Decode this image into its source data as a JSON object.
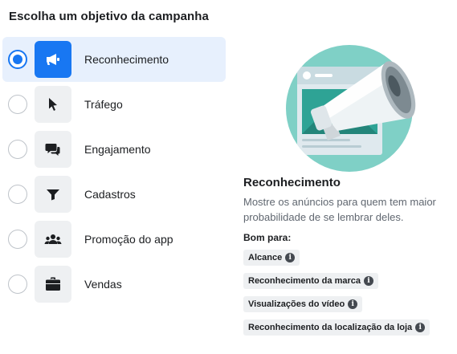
{
  "heading": "Escolha um objetivo da campanha",
  "options": [
    {
      "label": "Reconhecimento",
      "icon": "megaphone-icon",
      "selected": true
    },
    {
      "label": "Tráfego",
      "icon": "cursor-icon",
      "selected": false
    },
    {
      "label": "Engajamento",
      "icon": "chat-bubbles-icon",
      "selected": false
    },
    {
      "label": "Cadastros",
      "icon": "filter-funnel-icon",
      "selected": false
    },
    {
      "label": "Promoção do app",
      "icon": "people-group-icon",
      "selected": false
    },
    {
      "label": "Vendas",
      "icon": "briefcase-icon",
      "selected": false
    }
  ],
  "detail": {
    "title": "Reconhecimento",
    "description": "Mostre os anúncios para quem tem maior probabilidade de se lembrar deles.",
    "good_for_label": "Bom para:",
    "chips": [
      "Alcance",
      "Reconhecimento da marca",
      "Visualizações do vídeo",
      "Reconhecimento da localização da loja"
    ]
  },
  "colors": {
    "accent": "#1877f2",
    "selected_bg": "#e7f0fd",
    "tile_bg": "#eef0f2",
    "illustration_teal": "#3fb7a6"
  }
}
